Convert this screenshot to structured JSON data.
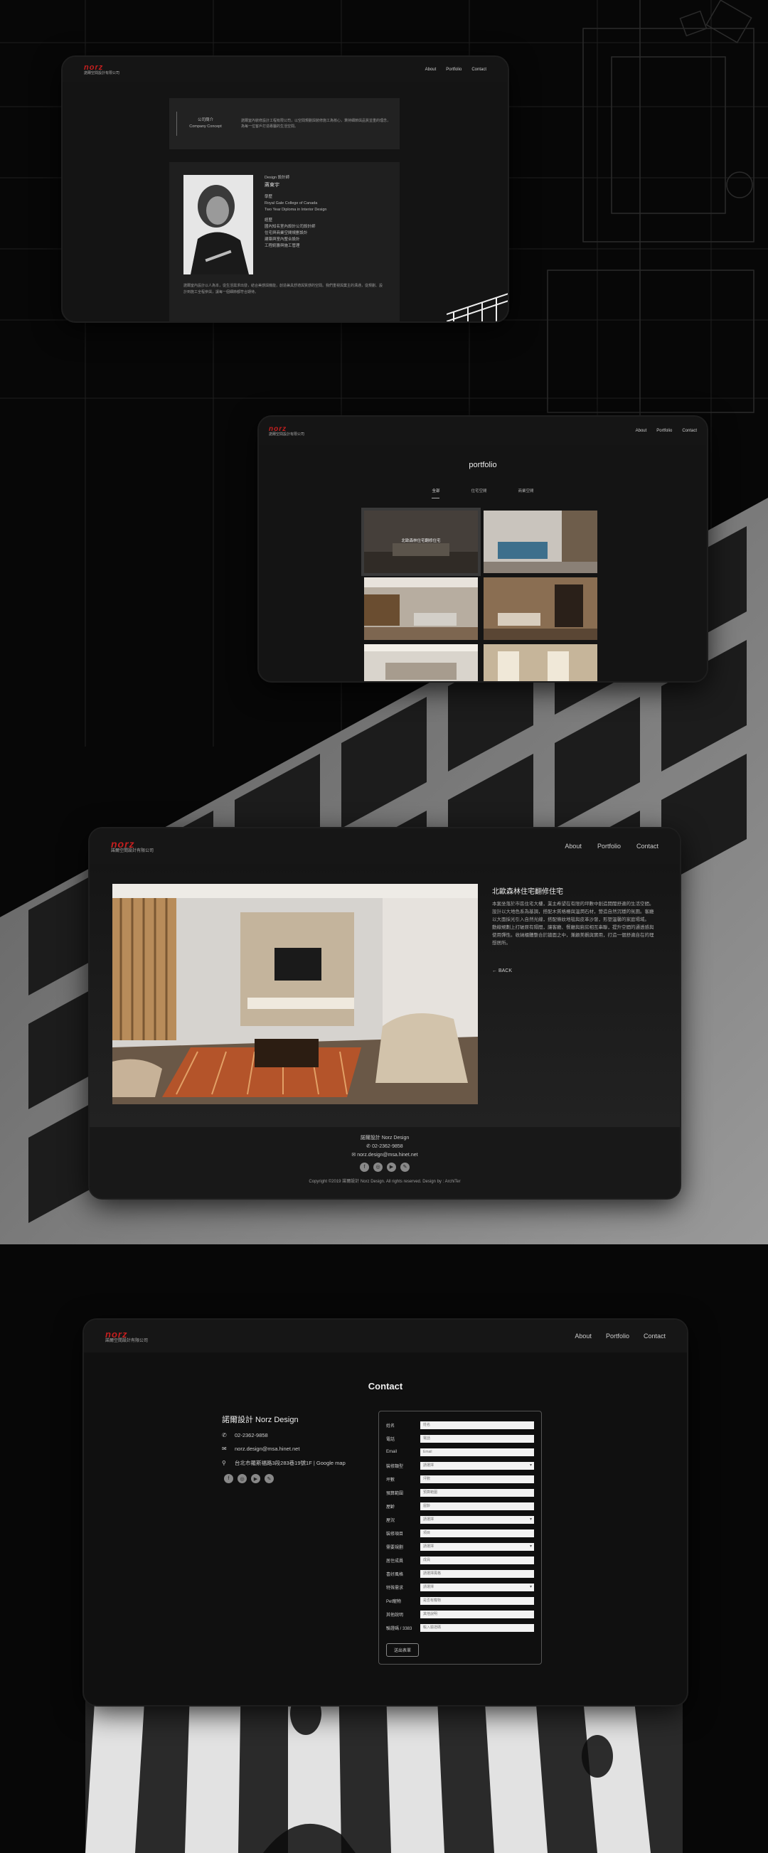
{
  "brand": {
    "logo_top": "norz",
    "logo_sub": "諾爾空間設計有限公司",
    "accent": "#c51f1f"
  },
  "nav": {
    "about": "About",
    "portfolio": "Portfolio",
    "contact": "Contact"
  },
  "about_page": {
    "company_title_zh": "公司簡介",
    "company_title_en": "Company Concept",
    "company_text": "諾爾室內裝修設計工程有限公司，以空間規劃與裝修施工為核心，秉持細節與品質並重的理念，為每一位客戶打造專屬的生活空間。",
    "designer_label": "Design 設計師",
    "designer_name": "蔣東宇",
    "education_label": "學歷",
    "education": [
      "Royal Gale College of Canada",
      "Two Year Diploma in Interior Design"
    ],
    "experience_label": "經歷",
    "experience": [
      "國內知名室內設計公司設計師",
      "住宅與商業空間規劃設計",
      "建築與室內整合設計",
      "工程統籌與施工管理"
    ],
    "bio": "諾爾室內設計以人為本，從生活需求出發，結合美感與機能，創造兼具舒適與質感的空間。我們重視與業主的溝通，從規劃、設計到施工全程參與，讓每一個細節都符合期待。"
  },
  "portfolio_page": {
    "title": "portfolio",
    "tabs": [
      "全部",
      "住宅空間",
      "商業空間"
    ],
    "items": [
      {
        "caption": "北歐森林住宅翻修住宅"
      },
      {
        "caption": ""
      },
      {
        "caption": ""
      },
      {
        "caption": ""
      },
      {
        "caption": ""
      },
      {
        "caption": ""
      }
    ]
  },
  "detail_page": {
    "heading": "北歐森林住宅翻修住宅",
    "paragraph1": "本案坐落於市區住宅大樓，業主希望在有限的坪數中創造開闊舒適的生活空間。設計以大地色系為基調，搭配木質格柵與溫潤石材，營造自然沉穩的氛圍。客廳以大面採光引入自然光線，搭配條紋地毯與皮革沙發，形塑溫馨的家庭場域。",
    "paragraph2": "動線規劃上打破原有隔間，讓客廳、餐廳與廚房相互串聯，提升空間的通透感與使用彈性。收納櫃體整合於牆面之中，兼顧美觀與實用，打造一個舒適自在的理想居所。",
    "back": "← BACK",
    "footer_name": "諾爾設計 Norz Design",
    "footer_phone": "02-2362-9858",
    "footer_email": "norz.design@msa.hinet.net",
    "copyright": "Copyright ©2019 諾爾設計 Norz Design. All rights reserved. Design by : ArchiTer"
  },
  "contact_page": {
    "title": "Contact",
    "company": "諾爾設計 Norz Design",
    "phone": "02-2362-9858",
    "email": "norz.design@msa.hinet.net",
    "address": "台北市羅斯福路3段283巷19號1F | Google map",
    "form": [
      {
        "label": "姓名",
        "value": "姓名",
        "type": "text"
      },
      {
        "label": "電話",
        "value": "電話",
        "type": "text"
      },
      {
        "label": "Email",
        "value": "Email",
        "type": "text"
      },
      {
        "label": "裝修類型",
        "value": "請選擇",
        "type": "select"
      },
      {
        "label": "坪數",
        "value": "坪數",
        "type": "text"
      },
      {
        "label": "預算範圍",
        "value": "預算範圍",
        "type": "text"
      },
      {
        "label": "屋齡",
        "value": "屋齡",
        "type": "text"
      },
      {
        "label": "屋況",
        "value": "請選擇",
        "type": "select"
      },
      {
        "label": "裝修項目",
        "value": "項目",
        "type": "text"
      },
      {
        "label": "需要規劃",
        "value": "請選擇",
        "type": "select"
      },
      {
        "label": "居住成員",
        "value": "成員",
        "type": "text"
      },
      {
        "label": "喜好風格",
        "value": "請選擇風格",
        "type": "text"
      },
      {
        "label": "特殊需求",
        "value": "請選擇",
        "type": "select"
      },
      {
        "label": "Pet寵物",
        "value": "是否有寵物",
        "type": "text"
      },
      {
        "label": "其他說明",
        "value": "其他說明",
        "type": "text"
      },
      {
        "label": "驗證碼 / 3383",
        "value": "輸入驗證碼",
        "type": "text"
      }
    ],
    "submit": "送出表單"
  }
}
